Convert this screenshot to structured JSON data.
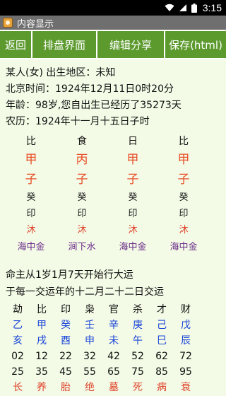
{
  "status": {
    "time": "3:15"
  },
  "title": "内容显示",
  "toolbar": {
    "back": "返回",
    "layout": "排盘界面",
    "share": "编辑分享",
    "save": "保存(html)"
  },
  "info": {
    "line1": "某人(女) 出生地区：未知",
    "line2": "北京时间：1924年12月11日0时20分",
    "line3": "年龄：98岁,您自出生已经历了35273天",
    "line4": "农历：1924年十一月十五日子时"
  },
  "pillars": [
    {
      "head": "比",
      "gan": "甲",
      "zhi": "子",
      "hide": "癸",
      "god": "印",
      "stage": "沐",
      "nayin": "海中金"
    },
    {
      "head": "食",
      "gan": "丙",
      "zhi": "子",
      "hide": "癸",
      "god": "印",
      "stage": "沐",
      "nayin": "涧下水"
    },
    {
      "head": "日",
      "gan": "甲",
      "zhi": "子",
      "hide": "癸",
      "god": "印",
      "stage": "沐",
      "nayin": "海中金"
    },
    {
      "head": "比",
      "gan": "甲",
      "zhi": "子",
      "hide": "癸",
      "god": "印",
      "stage": "沐",
      "nayin": "海中金"
    }
  ],
  "yun": {
    "line1": "命主从1岁1月7天开始行大运",
    "line2": "于每一交运年的十二月二十二日交运"
  },
  "dayun": {
    "gods": [
      "劫",
      "比",
      "印",
      "枭",
      "官",
      "杀",
      "才",
      "财"
    ],
    "gan": [
      "乙",
      "甲",
      "癸",
      "壬",
      "辛",
      "庚",
      "己",
      "戊"
    ],
    "zhi": [
      "亥",
      "戌",
      "酉",
      "申",
      "未",
      "午",
      "巳",
      "辰"
    ],
    "startAge": [
      "02",
      "12",
      "22",
      "32",
      "42",
      "52",
      "62",
      "72"
    ],
    "year": [
      "25",
      "35",
      "45",
      "55",
      "65",
      "75",
      "85",
      "95"
    ],
    "stage": [
      "长",
      "养",
      "胎",
      "绝",
      "墓",
      "死",
      "病",
      "衰"
    ]
  }
}
